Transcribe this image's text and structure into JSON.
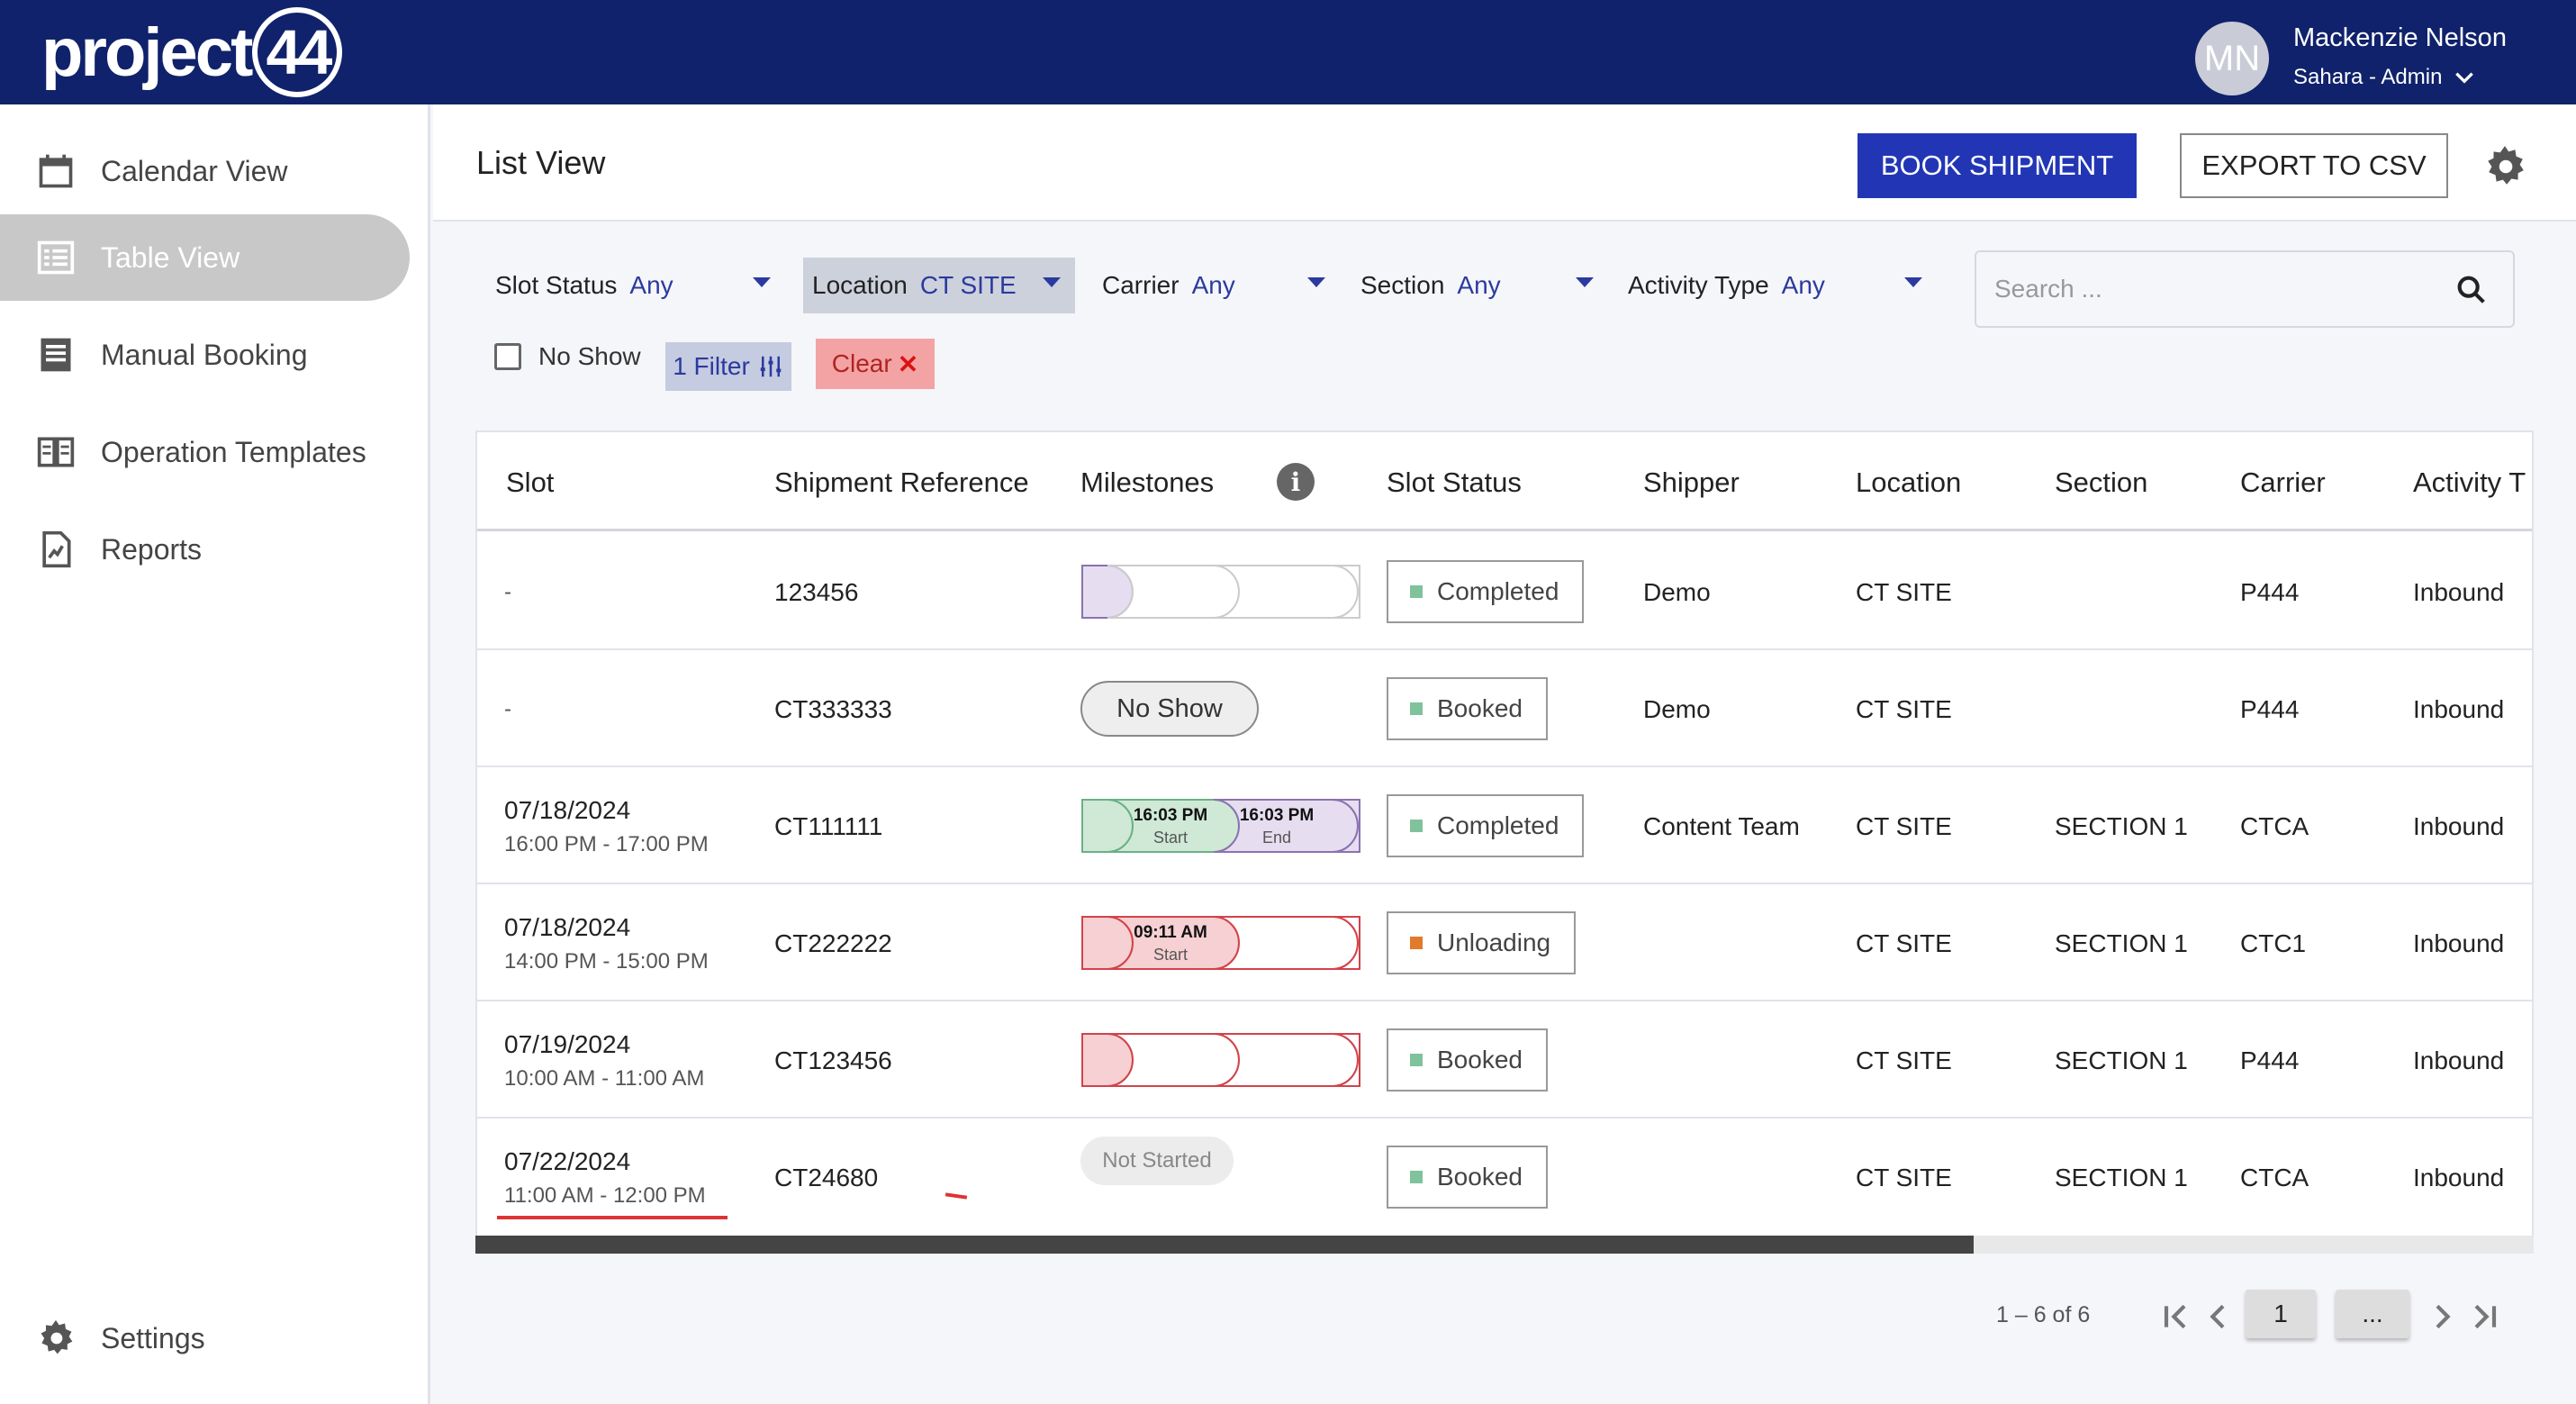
{
  "app": {
    "logo_text": "project",
    "logo_num": "44"
  },
  "user": {
    "initials": "MN",
    "name": "Mackenzie Nelson",
    "role": "Sahara - Admin"
  },
  "sidebar": {
    "items": [
      {
        "label": "Calendar View"
      },
      {
        "label": "Table View"
      },
      {
        "label": "Manual Booking"
      },
      {
        "label": "Operation Templates"
      },
      {
        "label": "Reports"
      }
    ],
    "settings_label": "Settings"
  },
  "header": {
    "title": "List View",
    "book_label": "BOOK SHIPMENT",
    "export_label": "EXPORT TO CSV"
  },
  "filters": {
    "slot_status": {
      "label": "Slot Status",
      "value": "Any"
    },
    "location": {
      "label": "Location",
      "value": "CT SITE"
    },
    "carrier": {
      "label": "Carrier",
      "value": "Any"
    },
    "section": {
      "label": "Section",
      "value": "Any"
    },
    "activity_type": {
      "label": "Activity Type",
      "value": "Any"
    },
    "search_placeholder": "Search ...",
    "no_show_label": "No Show",
    "filter_chip": "1 Filter",
    "clear_chip": "Clear"
  },
  "table": {
    "columns": {
      "slot": "Slot",
      "shipment_reference": "Shipment Reference",
      "milestones": "Milestones",
      "slot_status": "Slot Status",
      "shipper": "Shipper",
      "location": "Location",
      "section": "Section",
      "carrier": "Carrier",
      "activity": "Activity T"
    },
    "rows": [
      {
        "slot_date": "-",
        "slot_time": "",
        "ref": "123456",
        "status": "Completed",
        "status_color": "#7fc29b",
        "shipper": "Demo",
        "location": "CT SITE",
        "section": "",
        "carrier": "P444",
        "activity": "Inbound"
      },
      {
        "slot_date": "-",
        "slot_time": "",
        "ref": "CT333333",
        "milestone_pill": "No Show",
        "status": "Booked",
        "status_color": "#7fc29b",
        "shipper": "Demo",
        "location": "CT SITE",
        "section": "",
        "carrier": "P444",
        "activity": "Inbound"
      },
      {
        "slot_date": "07/18/2024",
        "slot_time": "16:00 PM - 17:00 PM",
        "ref": "CT111111",
        "ms_start_time": "16:03 PM",
        "ms_start_label": "Start",
        "ms_end_time": "16:03 PM",
        "ms_end_label": "End",
        "status": "Completed",
        "status_color": "#7fc29b",
        "shipper": "Content Team",
        "location": "CT SITE",
        "section": "SECTION 1",
        "carrier": "CTCA",
        "activity": "Inbound"
      },
      {
        "slot_date": "07/18/2024",
        "slot_time": "14:00 PM - 15:00 PM",
        "ref": "CT222222",
        "ms_start_time": "09:11 AM",
        "ms_start_label": "Start",
        "status": "Unloading",
        "status_color": "#e07a2c",
        "shipper": "",
        "location": "CT SITE",
        "section": "SECTION 1",
        "carrier": "CTC1",
        "activity": "Inbound"
      },
      {
        "slot_date": "07/19/2024",
        "slot_time": "10:00 AM - 11:00 AM",
        "ref": "CT123456",
        "status": "Booked",
        "status_color": "#7fc29b",
        "shipper": "",
        "location": "CT SITE",
        "section": "SECTION 1",
        "carrier": "P444",
        "activity": "Inbound"
      },
      {
        "slot_date": "07/22/2024",
        "slot_time": "11:00 AM - 12:00 PM",
        "ref": "CT24680",
        "milestone_pill": "Not Started",
        "status": "Booked",
        "status_color": "#7fc29b",
        "shipper": "",
        "location": "CT SITE",
        "section": "SECTION 1",
        "carrier": "CTCA",
        "activity": "Inbound"
      }
    ]
  },
  "pagination": {
    "range": "1 – 6 of 6",
    "current_page": "1",
    "more": "..."
  }
}
